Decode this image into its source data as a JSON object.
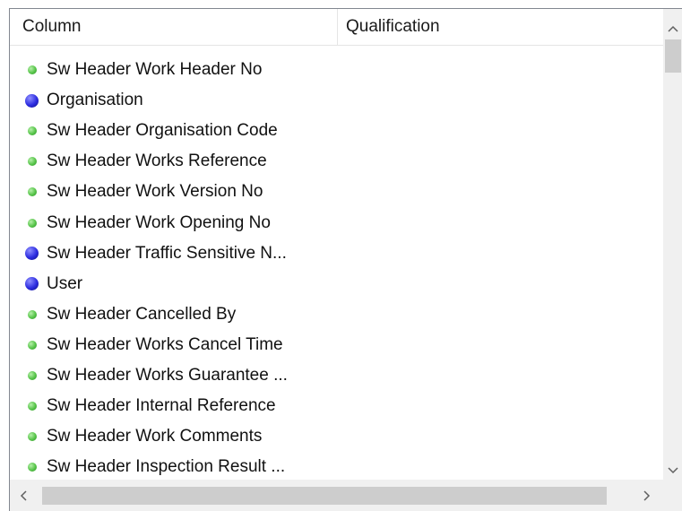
{
  "header": {
    "column_label": "Column",
    "qualification_label": "Qualification"
  },
  "rows": [
    {
      "label": "Sw Header  Work Header No",
      "dot": "green"
    },
    {
      "label": "Organisation",
      "dot": "blue"
    },
    {
      "label": "Sw Header  Organisation Code",
      "dot": "green"
    },
    {
      "label": "Sw Header  Works Reference",
      "dot": "green"
    },
    {
      "label": "Sw Header  Work Version No",
      "dot": "green"
    },
    {
      "label": "Sw Header  Work Opening No",
      "dot": "green"
    },
    {
      "label": "Sw Header  Traffic Sensitive N...",
      "dot": "blue"
    },
    {
      "label": "User",
      "dot": "blue"
    },
    {
      "label": "Sw Header  Cancelled By",
      "dot": "green"
    },
    {
      "label": "Sw Header  Works Cancel Time",
      "dot": "green"
    },
    {
      "label": "Sw Header  Works Guarantee ...",
      "dot": "green"
    },
    {
      "label": "Sw Header  Internal Reference",
      "dot": "green"
    },
    {
      "label": "Sw Header  Work Comments",
      "dot": "green"
    },
    {
      "label": "Sw Header  Inspection Result ...",
      "dot": "green"
    }
  ],
  "icons": {
    "scroll_up": "chevron-up-icon",
    "scroll_down": "chevron-down-icon",
    "scroll_left": "chevron-left-icon",
    "scroll_right": "chevron-right-icon",
    "green_dot": "green-dot-icon",
    "blue_dot": "blue-dot-icon"
  },
  "colors": {
    "green_dot": "#56c449",
    "blue_dot": "#2c2ce0",
    "scrollbar_track": "#f0f0f0",
    "scrollbar_thumb": "#cdcdcd",
    "border": "#828790"
  }
}
